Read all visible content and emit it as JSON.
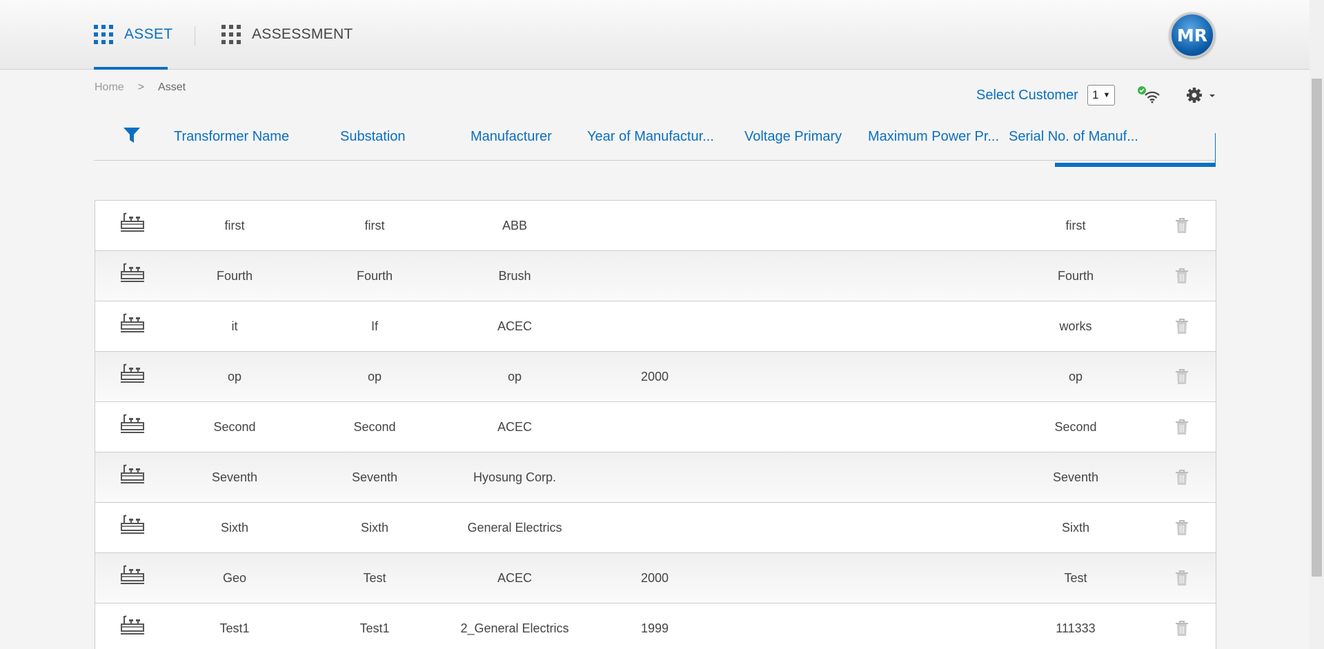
{
  "nav": {
    "asset_label": "ASSET",
    "assessment_label": "ASSESSMENT",
    "logo_text": "MR"
  },
  "breadcrumb": {
    "home": "Home",
    "separator": ">",
    "current": "Asset"
  },
  "toolbar": {
    "select_customer_label": "Select Customer",
    "customer_value": "1",
    "connection_status": "online"
  },
  "table": {
    "columns": [
      "Transformer Name",
      "Substation",
      "Manufacturer",
      "Year of Manufactur...",
      "Voltage Primary",
      "Maximum Power Pr...",
      "Serial No. of Manuf..."
    ],
    "rows": [
      {
        "name": "first",
        "substation": "first",
        "manufacturer": "ABB",
        "year": "",
        "voltage": "",
        "power": "",
        "serial": "first"
      },
      {
        "name": "Fourth",
        "substation": "Fourth",
        "manufacturer": "Brush",
        "year": "",
        "voltage": "",
        "power": "",
        "serial": "Fourth"
      },
      {
        "name": "it",
        "substation": "If",
        "manufacturer": "ACEC",
        "year": "",
        "voltage": "",
        "power": "",
        "serial": "works"
      },
      {
        "name": "op",
        "substation": "op",
        "manufacturer": "op",
        "year": "2000",
        "voltage": "",
        "power": "",
        "serial": "op"
      },
      {
        "name": "Second",
        "substation": "Second",
        "manufacturer": "ACEC",
        "year": "",
        "voltage": "",
        "power": "",
        "serial": "Second"
      },
      {
        "name": "Seventh",
        "substation": "Seventh",
        "manufacturer": "Hyosung Corp.",
        "year": "",
        "voltage": "",
        "power": "",
        "serial": "Seventh"
      },
      {
        "name": "Sixth",
        "substation": "Sixth",
        "manufacturer": "General Electrics",
        "year": "",
        "voltage": "",
        "power": "",
        "serial": "Sixth"
      },
      {
        "name": "Geo",
        "substation": "Test",
        "manufacturer": "ACEC",
        "year": "2000",
        "voltage": "",
        "power": "",
        "serial": "Test"
      },
      {
        "name": "Test1",
        "substation": "Test1",
        "manufacturer": "2_General Electrics",
        "year": "1999",
        "voltage": "",
        "power": "",
        "serial": "111333"
      }
    ]
  },
  "colors": {
    "accent": "#0a6fc2",
    "status_ok": "#3cb34a"
  }
}
